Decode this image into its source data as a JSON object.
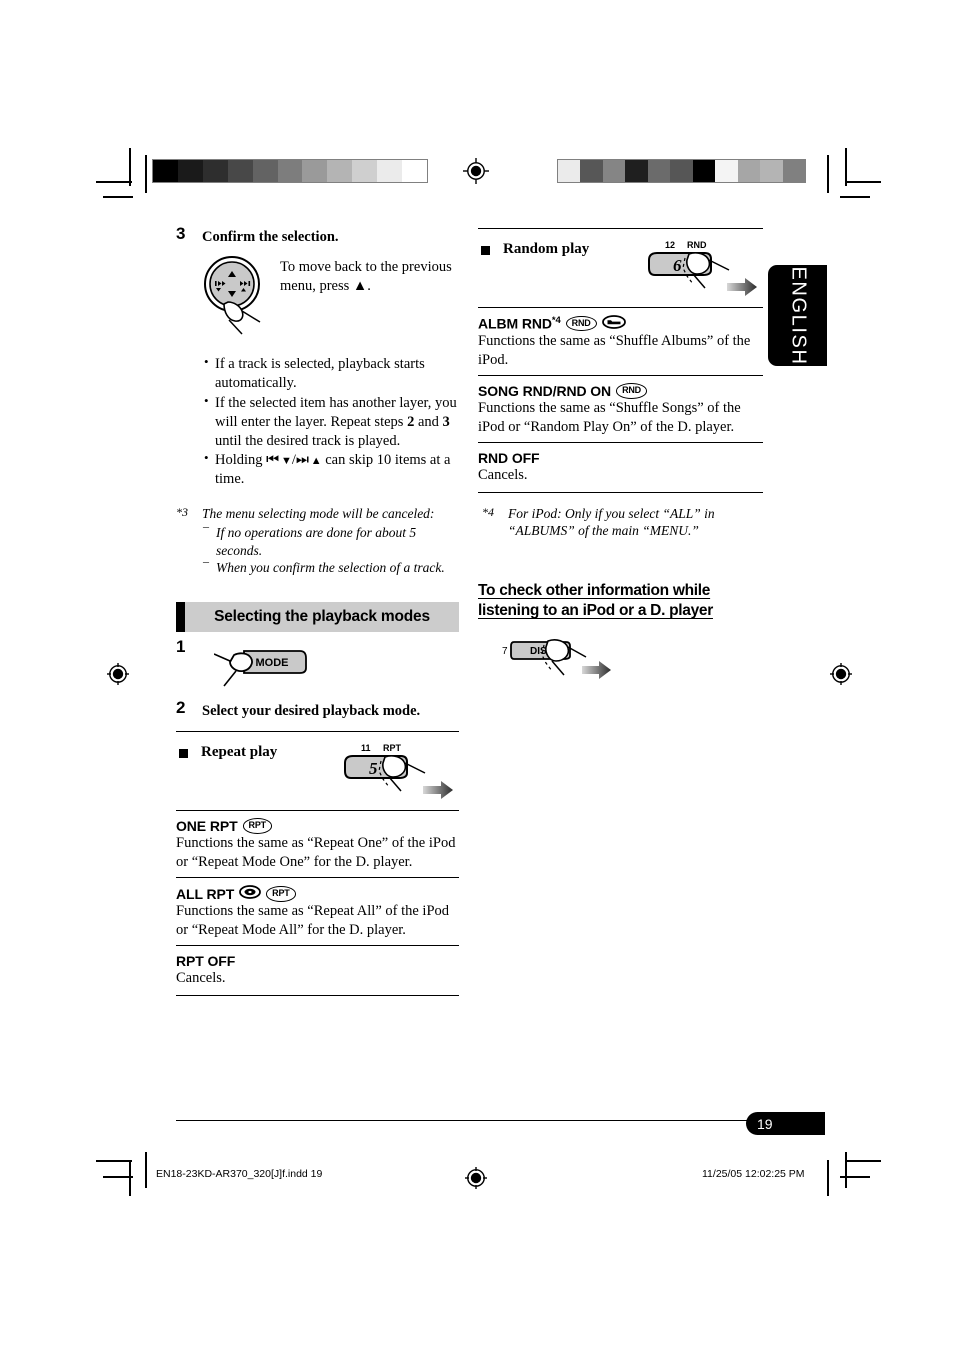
{
  "document": {
    "language_tab": "ENGLISH",
    "page_number": "19",
    "footer_file": "EN18-23KD-AR370_320[J]f.indd   19",
    "footer_timestamp": "11/25/05   12:02:25 PM"
  },
  "left_column": {
    "step3": {
      "number": "3",
      "title": "Confirm the selection.",
      "side_note": "To move back to the previous menu, press ▲.",
      "bullets": [
        "If a track is selected, playback starts automatically.",
        "If the selected item has another layer, you will enter the layer. Repeat steps 2 and 3 until the desired track is played.",
        "Holding ◀◀ ▼/▶▶ ▲ can skip 10 items at a time."
      ],
      "bullet2_pre": "If the selected item has another layer, you will enter the layer. Repeat steps ",
      "bullet2_b1": "2",
      "bullet2_mid": " and ",
      "bullet2_b2": "3",
      "bullet2_post": " until the desired track is played.",
      "bullet3_pre": "Holding ",
      "bullet3_post": " can skip 10 items at a time."
    },
    "footnote3": {
      "mark": "*3",
      "text": "The menu selecting mode will be canceled:",
      "items": [
        "If no operations are done for about 5 seconds.",
        "When you confirm the selection of a track."
      ]
    },
    "section_header": "Selecting the playback modes",
    "step1": {
      "number": "1",
      "button_label": "MODE"
    },
    "step2": {
      "number": "2",
      "title": "Select your desired playback mode."
    },
    "repeat": {
      "heading": "Repeat play",
      "button_number_label": "11",
      "button_func_label": "RPT",
      "button_key": "5",
      "entries": [
        {
          "name": "ONE RPT",
          "badges": [
            "RPT"
          ],
          "icons": [],
          "desc": "Functions the same as “Repeat One” of the iPod or “Repeat Mode One” for the D. player."
        },
        {
          "name": "ALL RPT",
          "badges": [
            "RPT"
          ],
          "icons": [
            "disc"
          ],
          "desc": "Functions the same as “Repeat All” of the iPod or “Repeat Mode All” for the D. player."
        },
        {
          "name": "RPT OFF",
          "badges": [],
          "icons": [],
          "desc": "Cancels."
        }
      ]
    }
  },
  "right_column": {
    "random": {
      "heading": "Random play",
      "button_number_label": "12",
      "button_func_label": "RND",
      "button_key": "6",
      "entries": [
        {
          "name": "ALBM RND",
          "footnote_ref": "*4",
          "badges": [
            "RND"
          ],
          "icons": [
            "folder"
          ],
          "desc": "Functions the same as “Shuffle Albums” of the iPod."
        },
        {
          "name": "SONG RND/RND ON",
          "footnote_ref": "",
          "badges": [
            "RND"
          ],
          "icons": [],
          "desc": "Functions the same as “Shuffle Songs” of the iPod or “Random Play On” of the D. player."
        },
        {
          "name": "RND OFF",
          "footnote_ref": "",
          "badges": [],
          "icons": [],
          "desc": "Cancels."
        }
      ]
    },
    "footnote4": {
      "mark": "*4",
      "text": "For iPod: Only if you select “ALL” in “ALBUMS” of the main “MENU.”"
    },
    "disp_section": {
      "heading": "To check other information while listening to an iPod or a D. player",
      "button_number_label": "7",
      "button_label": "DISP"
    }
  },
  "calibration": {
    "left_bar": [
      "#000000",
      "#1a1a1a",
      "#2e2e2e",
      "#484848",
      "#636363",
      "#7d7d7d",
      "#9a9a9a",
      "#b4b4b4",
      "#cfcfcf",
      "#ebebeb",
      "#ffffff"
    ],
    "right_bar": [
      "#ebebeb",
      "#575757",
      "#858585",
      "#1f1f1f",
      "#6b6b6b",
      "#565656",
      "#000000",
      "#f4f4f4",
      "#a6a6a6",
      "#b4b4b4",
      "#808080"
    ]
  }
}
